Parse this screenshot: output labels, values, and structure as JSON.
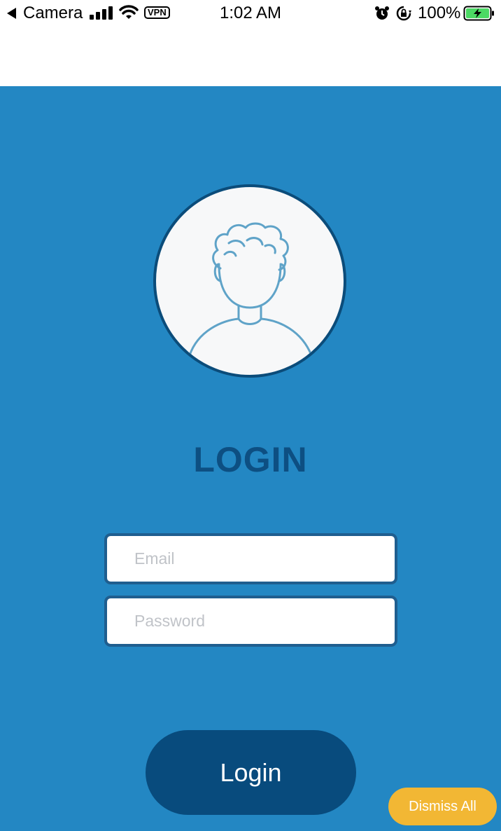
{
  "status_bar": {
    "back_label": "Camera",
    "time": "1:02 AM",
    "vpn": "VPN",
    "battery_percent": "100%",
    "icons": [
      "signal-icon",
      "wifi-icon",
      "alarm-icon",
      "rotation-lock-icon",
      "battery-charging-icon"
    ]
  },
  "login": {
    "title": "LOGIN",
    "email_placeholder": "Email",
    "password_placeholder": "Password",
    "submit_label": "Login",
    "avatar_icon": "user-avatar-icon"
  },
  "notification": {
    "dismiss_label": "Dismiss All"
  },
  "colors": {
    "background": "#2387c3",
    "title": "#0d4f82",
    "button": "#084b7d",
    "dismiss": "#f2b734"
  }
}
